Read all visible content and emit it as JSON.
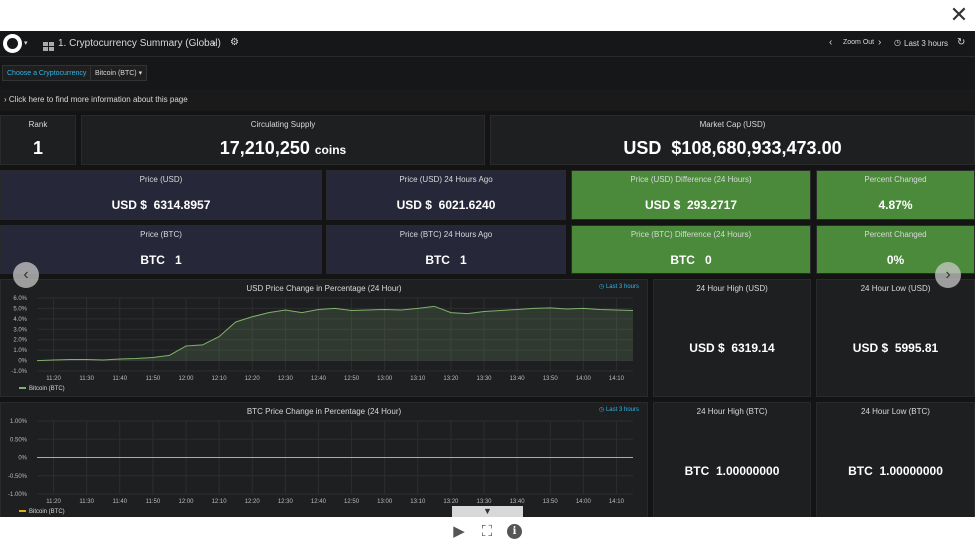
{
  "topbar": {
    "dashboard_title": "1. Cryptocurrency Summary (Global)",
    "zoom_out_label": "Zoom Out",
    "time_range_label": "Last 3 hours"
  },
  "variables": {
    "label": "Choose a Cryptocurrency",
    "value": "Bitcoin (BTC)"
  },
  "info_row": {
    "text": "Click here to find more information about this page"
  },
  "stats": {
    "rank": {
      "title": "Rank",
      "value": "1"
    },
    "supply": {
      "title": "Circulating Supply",
      "value": "17,210,250",
      "unit": "coins"
    },
    "market_cap": {
      "title": "Market Cap (USD)",
      "prefix": "USD",
      "value": "$108,680,933,473.00"
    },
    "price_usd": {
      "title": "Price (USD)",
      "prefix": "USD $",
      "value": "6314.8957"
    },
    "price_usd_24h": {
      "title": "Price (USD) 24 Hours Ago",
      "prefix": "USD $",
      "value": "6021.6240"
    },
    "price_usd_diff": {
      "title": "Price (USD) Difference (24 Hours)",
      "prefix": "USD $",
      "value": "293.2717"
    },
    "pct_usd": {
      "title": "Percent Changed",
      "value": "4.87%"
    },
    "price_btc": {
      "title": "Price (BTC)",
      "prefix": "BTC",
      "value": "1"
    },
    "price_btc_24h": {
      "title": "Price (BTC) 24 Hours Ago",
      "prefix": "BTC",
      "value": "1"
    },
    "price_btc_diff": {
      "title": "Price (BTC) Difference (24 Hours)",
      "prefix": "BTC",
      "value": "0"
    },
    "pct_btc": {
      "title": "Percent Changed",
      "value": "0%"
    },
    "high_usd": {
      "title": "24 Hour High (USD)",
      "prefix": "USD $",
      "value": "6319.14"
    },
    "low_usd": {
      "title": "24 Hour Low (USD)",
      "prefix": "USD $",
      "value": "5995.81"
    },
    "high_btc": {
      "title": "24 Hour High (BTC)",
      "prefix": "BTC",
      "value": "1.00000000"
    },
    "low_btc": {
      "title": "24 Hour Low (BTC)",
      "prefix": "BTC",
      "value": "1.00000000"
    }
  },
  "colors": {
    "green_panel": "#4a8a3a",
    "purple_panel": "#27273a",
    "link": "#33b5e5",
    "series_usd": "#7eb26d",
    "series_btc": "#e5ac0e"
  },
  "chart_data": [
    {
      "type": "area",
      "title": "USD Price Change in Percentage (24 Hour)",
      "range_label": "Last 3 hours",
      "x_ticks": [
        "11:20",
        "11:30",
        "11:40",
        "11:50",
        "12:00",
        "12:10",
        "12:20",
        "12:30",
        "12:40",
        "12:50",
        "13:00",
        "13:10",
        "13:20",
        "13:30",
        "13:40",
        "13:50",
        "14:00",
        "14:10"
      ],
      "y_ticks": [
        "6.0%",
        "5.0%",
        "4.0%",
        "3.0%",
        "2.0%",
        "1.0%",
        "0%",
        "-1.0%"
      ],
      "ylim": [
        -1,
        6
      ],
      "grid": true,
      "legend_position": "bottom-left",
      "series": [
        {
          "name": "Bitcoin (BTC)",
          "x": [
            "11:15",
            "11:20",
            "11:25",
            "11:30",
            "11:35",
            "11:40",
            "11:45",
            "11:50",
            "11:55",
            "12:00",
            "12:05",
            "12:10",
            "12:15",
            "12:20",
            "12:25",
            "12:30",
            "12:35",
            "12:40",
            "12:45",
            "12:50",
            "12:55",
            "13:00",
            "13:05",
            "13:10",
            "13:15",
            "13:20",
            "13:25",
            "13:30",
            "13:35",
            "13:40",
            "13:45",
            "13:50",
            "13:55",
            "14:00",
            "14:05",
            "14:10",
            "14:15"
          ],
          "values": [
            0.0,
            0.05,
            0.1,
            0.1,
            0.05,
            0.15,
            0.2,
            0.3,
            0.5,
            1.4,
            1.5,
            2.3,
            3.7,
            4.2,
            4.6,
            4.85,
            4.6,
            4.9,
            5.0,
            4.8,
            4.85,
            4.9,
            4.85,
            5.0,
            5.2,
            4.6,
            4.5,
            4.7,
            4.8,
            4.9,
            5.0,
            5.05,
            4.95,
            5.0,
            4.9,
            4.85,
            4.8
          ]
        }
      ]
    },
    {
      "type": "line",
      "title": "BTC Price Change in Percentage (24 Hour)",
      "range_label": "Last 3 hours",
      "x_ticks": [
        "11:20",
        "11:30",
        "11:40",
        "11:50",
        "12:00",
        "12:10",
        "12:20",
        "12:30",
        "12:40",
        "12:50",
        "13:00",
        "13:10",
        "13:20",
        "13:30",
        "13:40",
        "13:50",
        "14:00",
        "14:10"
      ],
      "y_ticks": [
        "1.00%",
        "0.50%",
        "0%",
        "-0.50%",
        "-1.00%"
      ],
      "ylim": [
        -1,
        1
      ],
      "grid": true,
      "legend_position": "bottom-left",
      "series": [
        {
          "name": "Bitcoin (BTC)",
          "x": [
            "11:15",
            "14:15"
          ],
          "values": [
            0,
            0
          ]
        }
      ]
    }
  ]
}
